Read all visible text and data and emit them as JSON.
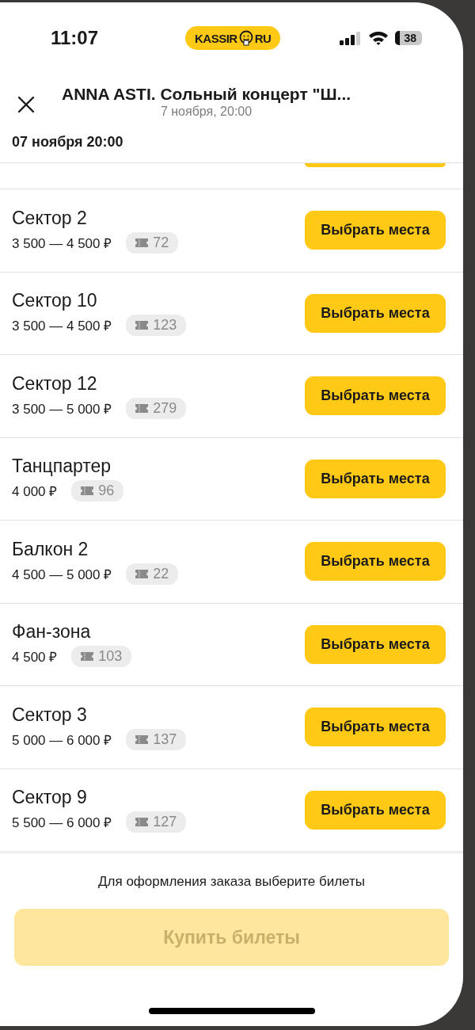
{
  "status_bar": {
    "time": "11:07",
    "logo": {
      "left": "KASSIR",
      "right": "RU"
    },
    "battery": "38"
  },
  "header": {
    "title": "ANNA ASTI. Сольный концерт \"Ш...",
    "subtitle": "7 ноября, 20:00"
  },
  "session": "07 ноября 20:00",
  "sectors": [
    {
      "name": "Сектор 2",
      "price": "3 500 — 4 500 ₽",
      "tickets": "72",
      "button": "Выбрать места"
    },
    {
      "name": "Сектор 10",
      "price": "3 500 — 4 500 ₽",
      "tickets": "123",
      "button": "Выбрать места"
    },
    {
      "name": "Сектор 12",
      "price": "3 500 — 5 000 ₽",
      "tickets": "279",
      "button": "Выбрать места"
    },
    {
      "name": "Танцпартер",
      "price": "4 000 ₽",
      "tickets": "96",
      "button": "Выбрать места"
    },
    {
      "name": "Балкон 2",
      "price": "4 500 — 5 000 ₽",
      "tickets": "22",
      "button": "Выбрать места"
    },
    {
      "name": "Фан-зона",
      "price": "4 500 ₽",
      "tickets": "103",
      "button": "Выбрать места"
    },
    {
      "name": "Сектор 3",
      "price": "5 000 — 6 000 ₽",
      "tickets": "137",
      "button": "Выбрать места"
    },
    {
      "name": "Сектор 9",
      "price": "5 500 — 6 000 ₽",
      "tickets": "127",
      "button": "Выбрать места"
    }
  ],
  "footer": {
    "hint": "Для оформления заказа выберите билеты",
    "buy_button": {
      "label": "Купить билеты",
      "disabled": true
    }
  }
}
